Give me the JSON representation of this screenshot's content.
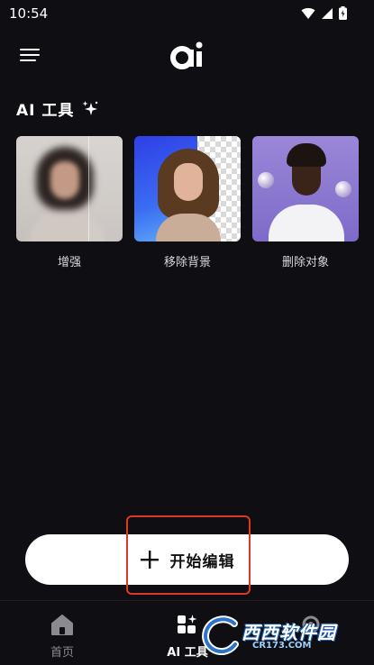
{
  "status_bar": {
    "time": "10:54",
    "icons": [
      "wifi-icon",
      "cellular-signal-icon",
      "battery-icon"
    ]
  },
  "header": {
    "logo_text": "ai",
    "menu_icon": "hamburger-menu-icon"
  },
  "section": {
    "title": "AI 工具",
    "title_icon": "sparkle-icon"
  },
  "tools": [
    {
      "label": "增强"
    },
    {
      "label": "移除背景"
    },
    {
      "label": "删除对象"
    }
  ],
  "start_button": {
    "icon": "plus-icon",
    "label": "开始编辑",
    "highlight_color": "#e0352b"
  },
  "bottom_nav": {
    "items": [
      {
        "label": "首页",
        "icon": "home-icon",
        "active": false
      },
      {
        "label": "AI 工具",
        "icon": "grid-sparkle-icon",
        "active": true
      },
      {
        "label": "",
        "icon": "settings-icon",
        "active": false
      }
    ]
  },
  "watermark": {
    "text": "西西软件园",
    "url": "CR173.COM"
  },
  "colors": {
    "background": "#0f0f13",
    "accent_button": "#ffffff",
    "inactive_nav": "#8a8a90"
  }
}
